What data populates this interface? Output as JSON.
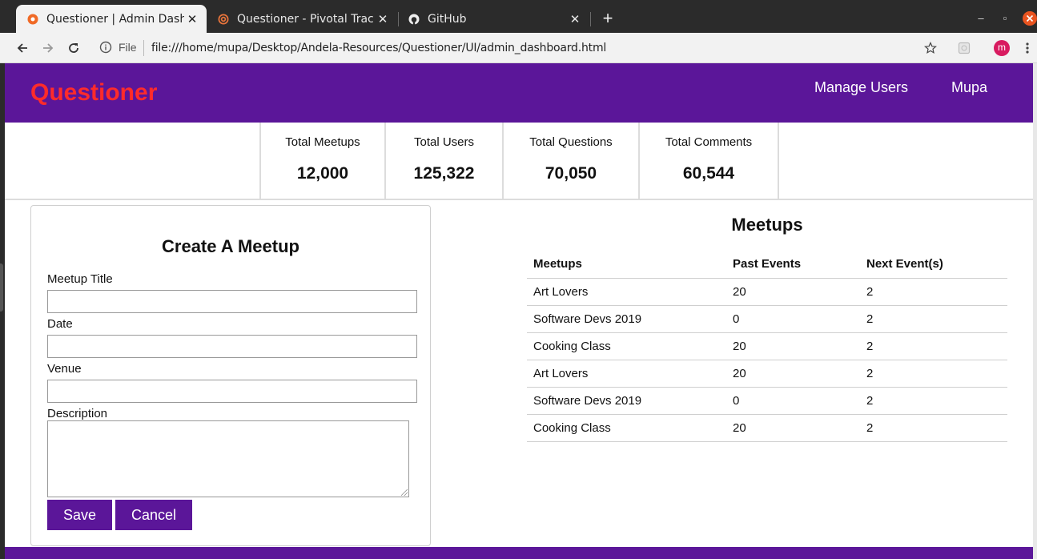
{
  "browser": {
    "tabs": [
      {
        "title": "Questioner | Admin Dashb",
        "icon": "html-file-icon",
        "active": true
      },
      {
        "title": "Questioner - Pivotal Track",
        "icon": "pivotal-tracker-icon",
        "active": false
      },
      {
        "title": "GitHub",
        "icon": "github-icon",
        "active": false
      }
    ],
    "security_label": "File",
    "url": "file:///home/mupa/Desktop/Andela-Resources/Questioner/UI/admin_dashboard.html",
    "profile_initial": "m",
    "accent_color": "#d81b60"
  },
  "navbar": {
    "brand": "Questioner",
    "links": [
      "Manage Users",
      "Mupa"
    ],
    "bg_color": "#5b1699",
    "brand_color": "#ff2b2b"
  },
  "stats": [
    {
      "label": "Total Meetups",
      "value": "12,000"
    },
    {
      "label": "Total Users",
      "value": "125,322"
    },
    {
      "label": "Total Questions",
      "value": "70,050"
    },
    {
      "label": "Total Comments",
      "value": "60,544"
    }
  ],
  "form": {
    "title": "Create A Meetup",
    "fields": {
      "title_label": "Meetup Title",
      "date_label": "Date",
      "venue_label": "Venue",
      "description_label": "Description"
    },
    "save_label": "Save",
    "cancel_label": "Cancel"
  },
  "meetups": {
    "title": "Meetups",
    "columns": [
      "Meetups",
      "Past Events",
      "Next Event(s)"
    ],
    "rows": [
      [
        "Art Lovers",
        "20",
        "2"
      ],
      [
        "Software Devs 2019",
        "0",
        "2"
      ],
      [
        "Cooking Class",
        "20",
        "2"
      ],
      [
        "Art Lovers",
        "20",
        "2"
      ],
      [
        "Software Devs 2019",
        "0",
        "2"
      ],
      [
        "Cooking Class",
        "20",
        "2"
      ]
    ]
  }
}
